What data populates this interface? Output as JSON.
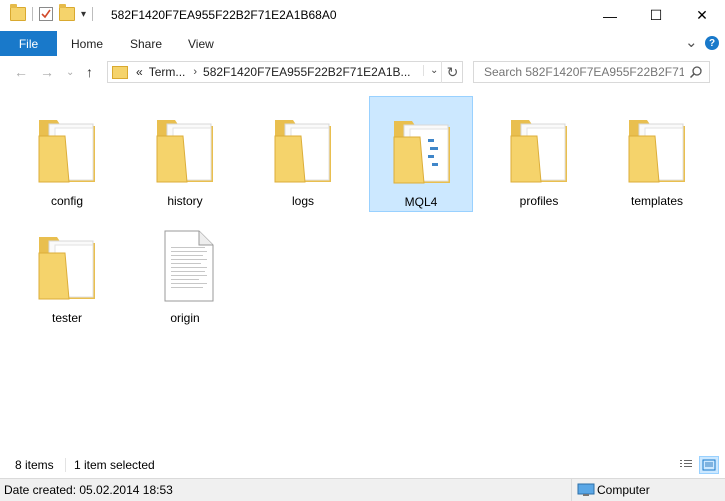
{
  "window": {
    "title": "582F1420F7EA955F22B2F71E2A1B68A0",
    "minimize": "—",
    "maximize": "☐",
    "close": "✕"
  },
  "ribbon": {
    "tabs": [
      "File",
      "Home",
      "Share",
      "View"
    ],
    "expand": "⌄",
    "help": "?"
  },
  "address": {
    "overflow": "«",
    "segments": [
      "Term...",
      "582F1420F7EA955F22B2F71E2A1B..."
    ],
    "search_placeholder": "Search 582F1420F7EA955F22B2F71E2..."
  },
  "items": [
    {
      "name": "config",
      "icon": "folder-icon",
      "selected": false
    },
    {
      "name": "history",
      "icon": "folder-icon",
      "selected": false
    },
    {
      "name": "logs",
      "icon": "folder-icon",
      "selected": false
    },
    {
      "name": "MQL4",
      "icon": "folder-icon",
      "selected": true
    },
    {
      "name": "profiles",
      "icon": "folder-icon",
      "selected": false
    },
    {
      "name": "templates",
      "icon": "folder-icon",
      "selected": false
    },
    {
      "name": "tester",
      "icon": "folder-icon",
      "selected": false
    },
    {
      "name": "origin",
      "icon": "file-icon",
      "selected": false
    }
  ],
  "status": {
    "count": "8 items",
    "selection": "1 item selected"
  },
  "details": {
    "date_created": "Date created: 05.02.2014 18:53",
    "location": "Computer"
  },
  "colors": {
    "accent": "#1979ca",
    "selection_bg": "#cce8ff",
    "selection_border": "#99d1ff",
    "folder": "#f5d36b"
  }
}
